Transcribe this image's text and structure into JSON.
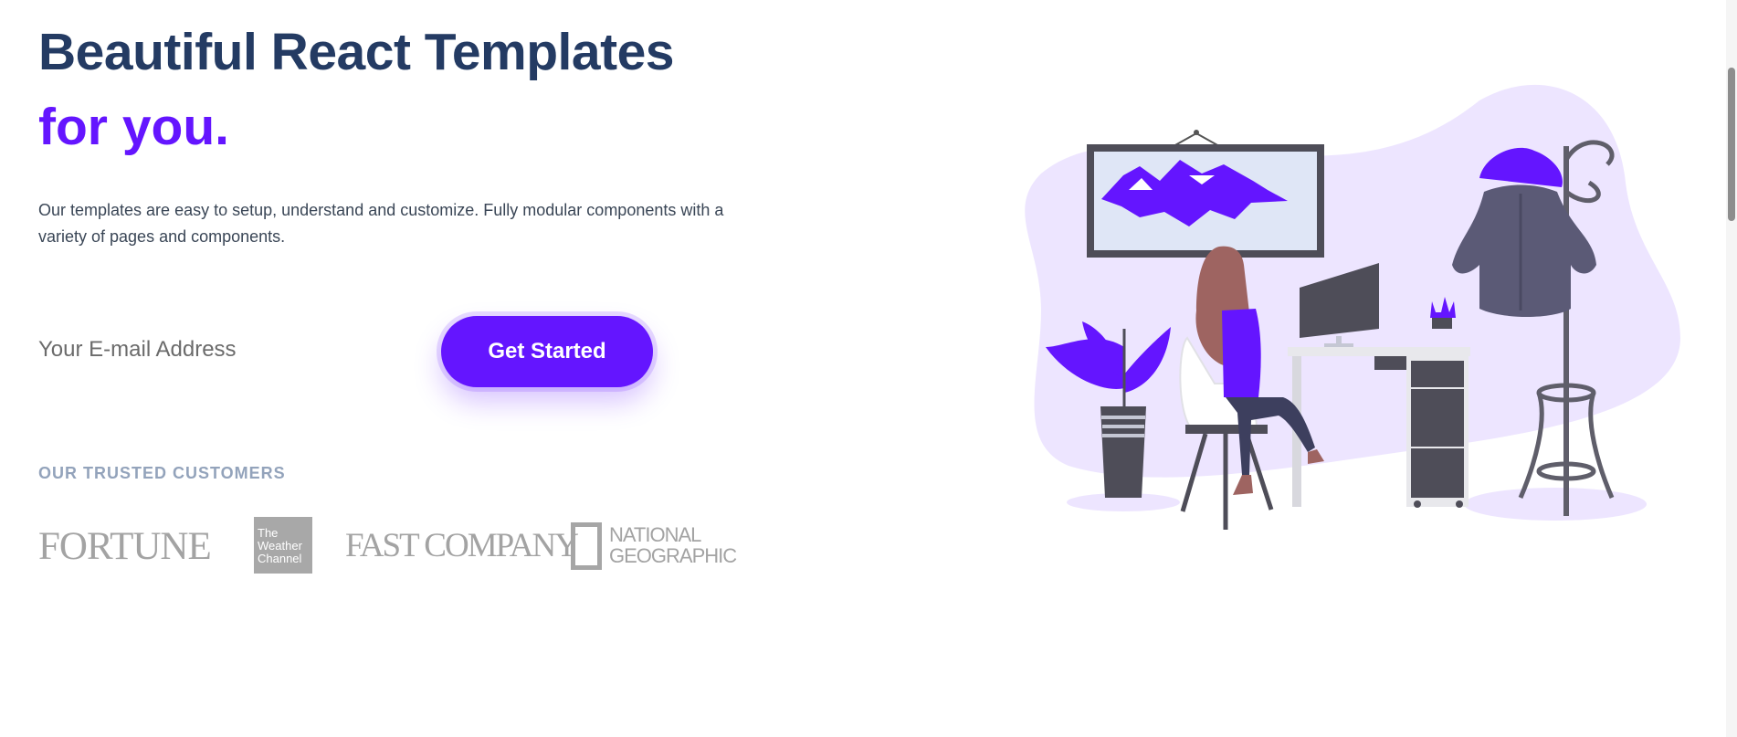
{
  "hero": {
    "title_line1": "Beautiful React Templates",
    "title_line2": "for you.",
    "description": "Our templates are easy to setup, understand and customize. Fully modular components with a variety of pages and components."
  },
  "signup": {
    "email_placeholder": "Your E-mail Address",
    "button_label": "Get Started"
  },
  "customers": {
    "heading": "OUR TRUSTED CUSTOMERS",
    "logos": [
      "FORTUNE",
      "The\nWeather\nChannel",
      "FAST COMPANY",
      "NATIONAL\nGEOGRAPHIC"
    ]
  },
  "illustration": {
    "icon": "person-at-desk-illustration"
  },
  "colors": {
    "primary": "#6415ff",
    "heading": "#243b63",
    "muted": "#93a3bb"
  }
}
